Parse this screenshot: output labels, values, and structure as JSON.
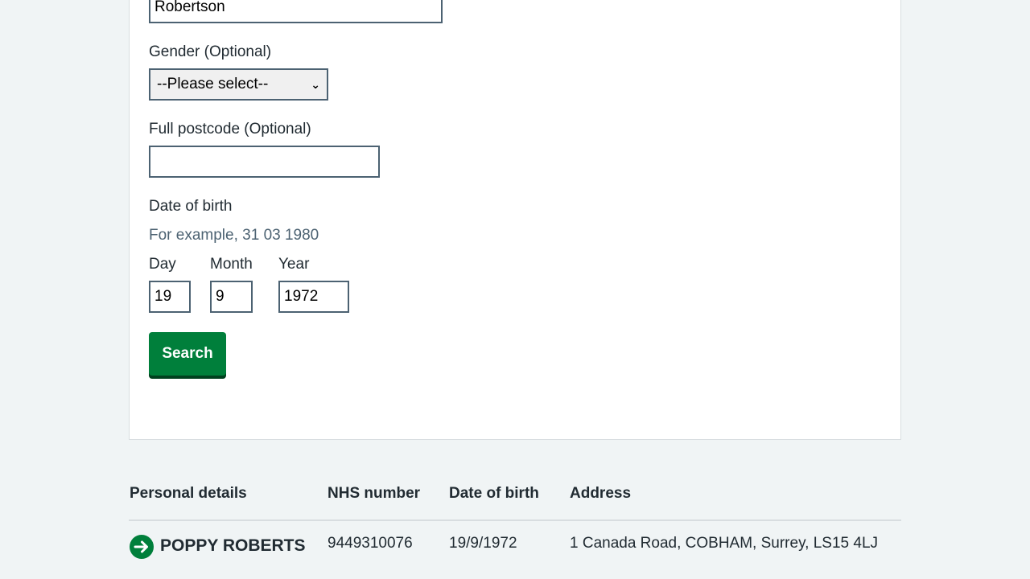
{
  "form": {
    "surname_value": "Robertson",
    "gender": {
      "label": "Gender (Optional)",
      "selected": "--Please select--"
    },
    "postcode": {
      "label": "Full postcode (Optional)",
      "value": ""
    },
    "dob": {
      "label": "Date of birth",
      "hint": "For example, 31 03 1980",
      "day": {
        "label": "Day",
        "value": "19"
      },
      "month": {
        "label": "Month",
        "value": "9"
      },
      "year": {
        "label": "Year",
        "value": "1972"
      }
    },
    "search_label": "Search"
  },
  "results": {
    "headers": [
      "Personal details",
      "NHS number",
      "Date of birth",
      "Address"
    ],
    "rows": [
      {
        "name": "POPPY ROBERTS",
        "nhs_number": "9449310076",
        "dob": "19/9/1972",
        "address": "1 Canada Road, COBHAM, Surrey, LS15 4LJ"
      }
    ]
  },
  "colors": {
    "primary_green": "#007f3b",
    "background": "#f0f4f5",
    "text": "#212b32",
    "hint": "#4c6272"
  }
}
